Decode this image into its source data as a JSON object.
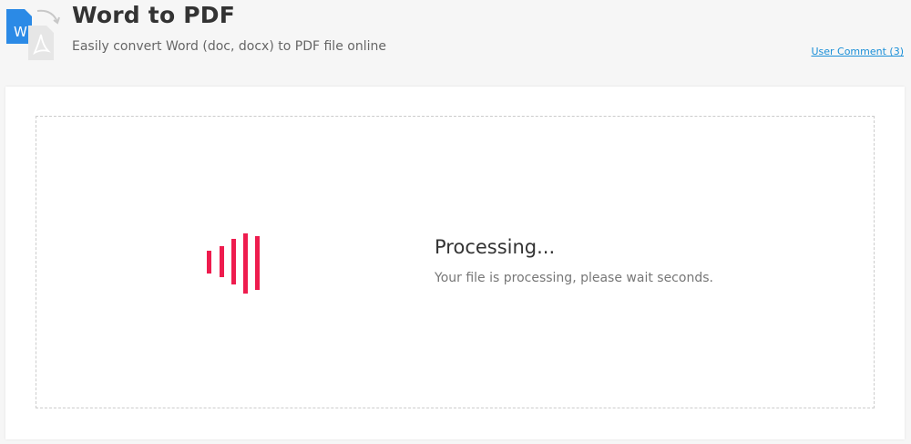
{
  "header": {
    "title": "Word to PDF",
    "subtitle": "Easily convert Word (doc, docx) to PDF file online",
    "user_comment_link": "User Comment (3)"
  },
  "logo": {
    "word_letter": "W",
    "word_color": "#2b8ae6",
    "pdf_color": "#e6e6e6"
  },
  "processing": {
    "title": "Processing...",
    "description": "Your file is processing, please wait seconds.",
    "spinner_color": "#ee1c4e"
  }
}
